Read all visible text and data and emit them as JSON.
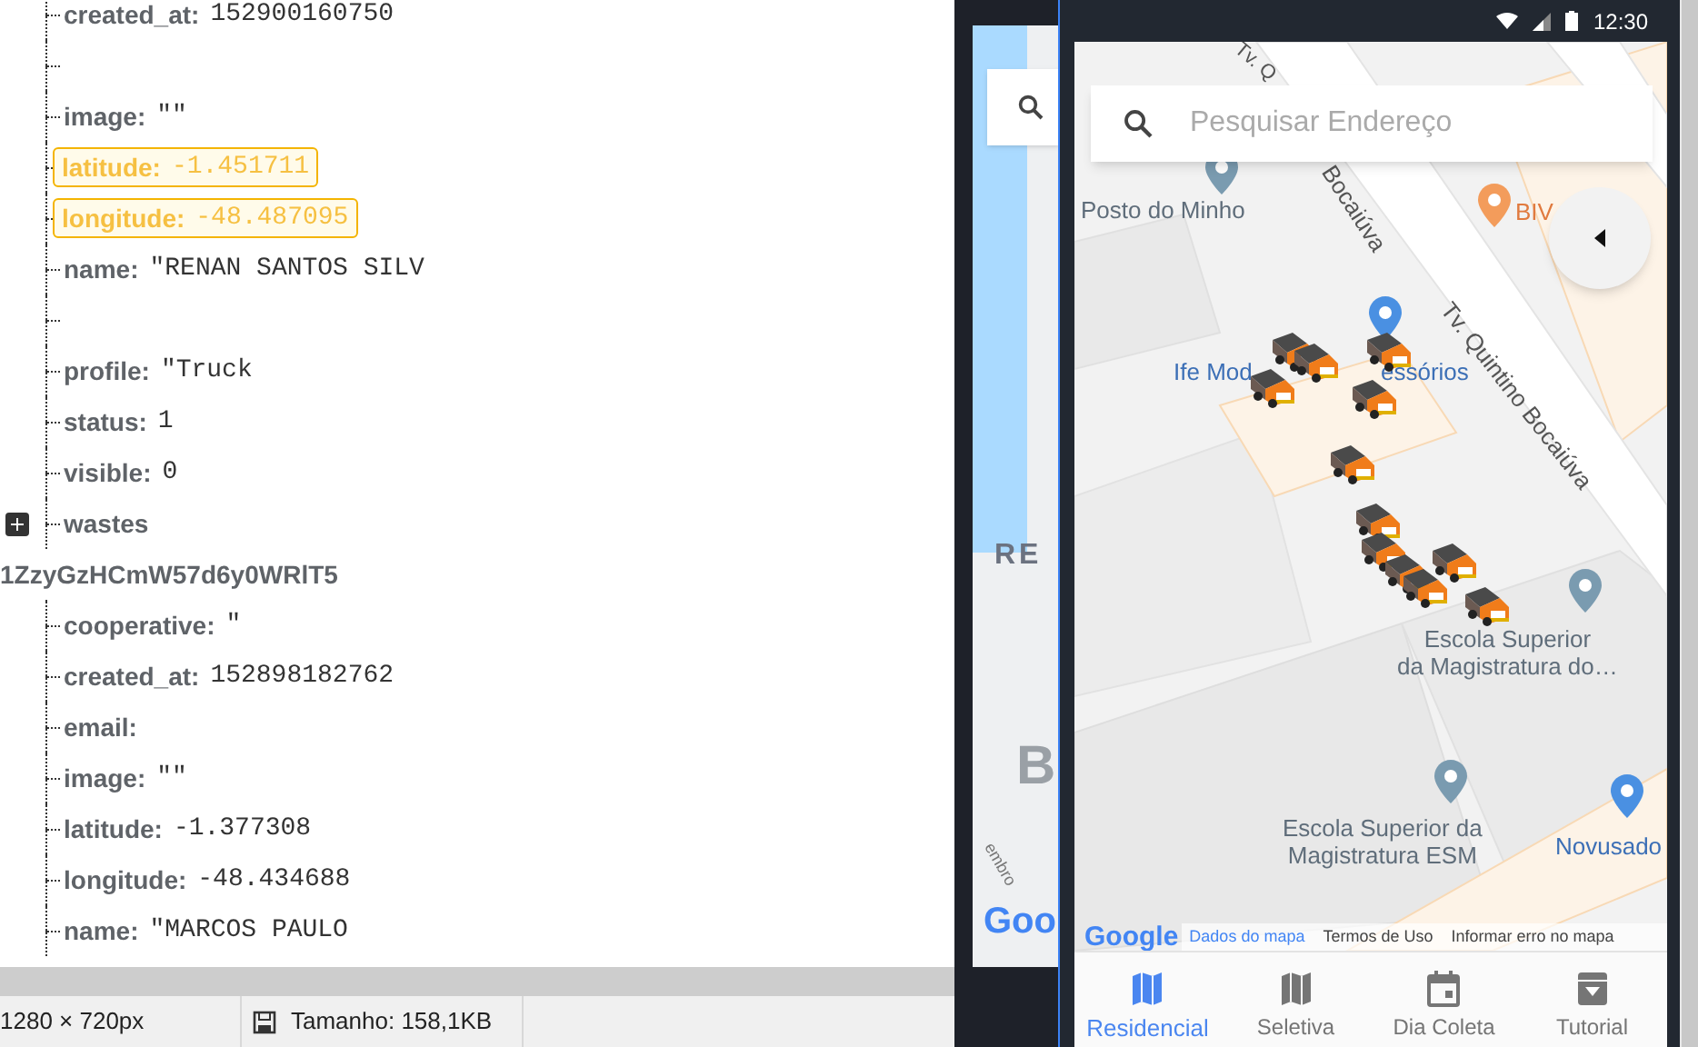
{
  "record_1_fields": [
    {
      "kind": "field",
      "key": "created_at:",
      "value": "152900160750",
      "highlighted": false
    },
    {
      "kind": "blank"
    },
    {
      "kind": "field",
      "key": "image:",
      "value": "\"\"",
      "highlighted": false
    },
    {
      "kind": "field",
      "key": "latitude:",
      "value": "-1.451711",
      "highlighted": true
    },
    {
      "kind": "field",
      "key": "longitude:",
      "value": "-48.487095",
      "highlighted": true
    },
    {
      "kind": "field",
      "key": "name:",
      "value": "\"RENAN SANTOS SILV",
      "highlighted": false
    },
    {
      "kind": "blank"
    },
    {
      "kind": "field",
      "key": "profile:",
      "value": "\"Truck",
      "highlighted": false
    },
    {
      "kind": "field",
      "key": "status:",
      "value": "1",
      "highlighted": false
    },
    {
      "kind": "field",
      "key": "visible:",
      "value": "0",
      "highlighted": false
    },
    {
      "kind": "collapsed",
      "key": "wastes"
    }
  ],
  "record_2": {
    "key": "1ZzyGzHCmW57d6y0WRlT5",
    "children": [
      {
        "kind": "field",
        "key": "cooperative:",
        "value": "\"",
        "highlighted": false
      },
      {
        "kind": "field",
        "key": "created_at:",
        "value": "152898182762",
        "highlighted": false
      },
      {
        "kind": "field",
        "key": "email:",
        "highlighted": false
      },
      {
        "kind": "field",
        "key": "image:",
        "value": "\"\"",
        "highlighted": false
      },
      {
        "kind": "field",
        "key": "latitude:",
        "value": "-1.377308",
        "highlighted": false
      },
      {
        "kind": "field",
        "key": "longitude:",
        "value": "-48.434688",
        "highlighted": false
      },
      {
        "kind": "field",
        "key": "name:",
        "value": "\"MARCOS PAULO",
        "highlighted": false
      }
    ]
  },
  "status_bar": {
    "dimensions": "1280 × 720px",
    "size": "Tamanho: 158,1KB"
  },
  "back_map": {
    "labels": [
      "RE",
      "B",
      "embro",
      "Goo"
    ]
  },
  "phone": {
    "time": "12:30",
    "search": {
      "placeholder": "Pesquisar Endereço"
    },
    "map_labels": [
      {
        "text": "Tv. Q",
        "kind": "street"
      },
      {
        "text": "Bocaiúva",
        "kind": "street"
      },
      {
        "text": "Tv. Quintino Bocaiúva",
        "kind": "street"
      },
      {
        "text": "Posto do Minho",
        "kind": "place"
      },
      {
        "text": "BIV",
        "kind": "food"
      },
      {
        "text": "Ife Mod",
        "kind": "shop"
      },
      {
        "text": "essórios",
        "kind": "shop"
      },
      {
        "text": "Escola Superior\nda Magistratura do…",
        "kind": "place"
      },
      {
        "text": "Escola Superior da\nMagistratura ESM",
        "kind": "place"
      },
      {
        "text": "Novusado",
        "kind": "shop"
      }
    ],
    "google": "Google",
    "attribution": [
      {
        "text": "Dados do mapa",
        "kind": "link"
      },
      {
        "text": "Termos de Uso",
        "kind": "plain"
      },
      {
        "text": "Informar erro no mapa",
        "kind": "plain"
      }
    ],
    "nav": [
      {
        "label": "Residencial",
        "selected": true
      },
      {
        "label": "Seletiva",
        "selected": false
      },
      {
        "label": "Dia Coleta",
        "selected": false
      },
      {
        "label": "Tutorial",
        "selected": false
      }
    ]
  }
}
